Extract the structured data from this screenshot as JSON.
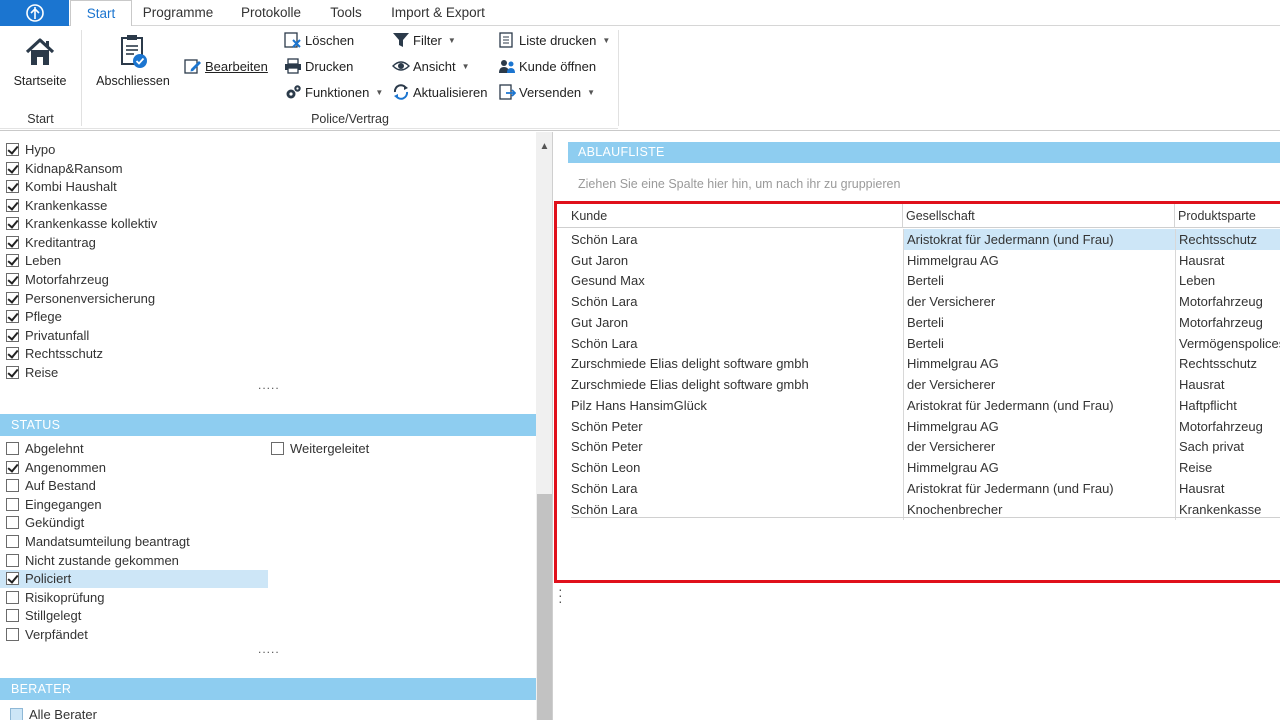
{
  "ribbon_tabs": [
    "Start",
    "Programme",
    "Protokolle",
    "Tools",
    "Import & Export"
  ],
  "ribbon": {
    "start_group": {
      "startseite": "Startseite",
      "label": "Start"
    },
    "police_group": {
      "abschliessen": "Abschliessen",
      "bearbeiten": "Bearbeiten",
      "loeschen": "Löschen",
      "drucken": "Drucken",
      "funktionen": "Funktionen",
      "filter": "Filter",
      "ansicht": "Ansicht",
      "aktualisieren": "Aktualisieren",
      "liste_drucken": "Liste drucken",
      "kunde_oeffnen": "Kunde öffnen",
      "versenden": "Versenden",
      "label": "Police/Vertrag"
    }
  },
  "sparten": [
    {
      "label": "Hypo",
      "checked": true
    },
    {
      "label": "Kidnap&Ransom",
      "checked": true
    },
    {
      "label": "Kombi Haushalt",
      "checked": true
    },
    {
      "label": "Krankenkasse",
      "checked": true
    },
    {
      "label": "Krankenkasse kollektiv",
      "checked": true
    },
    {
      "label": "Kreditantrag",
      "checked": true
    },
    {
      "label": "Leben",
      "checked": true
    },
    {
      "label": "Motorfahrzeug",
      "checked": true
    },
    {
      "label": "Personenversicherung",
      "checked": true
    },
    {
      "label": "Pflege",
      "checked": true
    },
    {
      "label": "Privatunfall",
      "checked": true
    },
    {
      "label": "Rechtsschutz",
      "checked": true
    },
    {
      "label": "Reise",
      "checked": true
    }
  ],
  "more_dots": ".....",
  "status": {
    "header": "STATUS",
    "items": [
      {
        "label": "Abgelehnt",
        "checked": false
      },
      {
        "label": "Angenommen",
        "checked": true
      },
      {
        "label": "Auf Bestand",
        "checked": false
      },
      {
        "label": "Eingegangen",
        "checked": false
      },
      {
        "label": "Gekündigt",
        "checked": false
      },
      {
        "label": "Mandatsumteilung beantragt",
        "checked": false
      },
      {
        "label": "Nicht zustande gekommen",
        "checked": false
      },
      {
        "label": "Policiert",
        "checked": true
      },
      {
        "label": "Risikoprüfung",
        "checked": false
      },
      {
        "label": "Stillgelegt",
        "checked": false
      },
      {
        "label": "Verpfändet",
        "checked": false
      }
    ],
    "extra": {
      "label": "Weitergeleitet",
      "checked": false
    }
  },
  "berater": {
    "header": "BERATER",
    "all_label": "Alle Berater"
  },
  "ablaufliste": {
    "header": "ABLAUFLISTE",
    "group_hint": "Ziehen Sie eine Spalte hier hin, um nach ihr zu gruppieren",
    "columns": [
      "Kunde",
      "Gesellschaft",
      "Produktsparte"
    ],
    "rows": [
      [
        "Schön Lara",
        "Aristokrat für Jedermann (und Frau)",
        "Rechtsschutz"
      ],
      [
        "Gut Jaron",
        "Himmelgrau AG",
        "Hausrat"
      ],
      [
        "Gesund Max",
        "Berteli",
        "Leben"
      ],
      [
        "Schön Lara",
        "der Versicherer",
        "Motorfahrzeug"
      ],
      [
        "Gut Jaron",
        "Berteli",
        "Motorfahrzeug"
      ],
      [
        "Schön Lara",
        "Berteli",
        "Vermögenspolices"
      ],
      [
        "Zurschmiede Elias delight software gmbh",
        "Himmelgrau AG",
        "Rechtsschutz"
      ],
      [
        "Zurschmiede Elias delight software gmbh",
        "der Versicherer",
        "Hausrat"
      ],
      [
        "Pilz Hans HansimGlück",
        "Aristokrat für Jedermann (und Frau)",
        "Haftpflicht"
      ],
      [
        "Schön Peter",
        "Himmelgrau AG",
        "Motorfahrzeug"
      ],
      [
        "Schön Peter",
        "der Versicherer",
        "Sach privat"
      ],
      [
        "Schön Leon",
        "Himmelgrau AG",
        "Reise"
      ],
      [
        "Schön Lara",
        "Aristokrat für Jedermann (und Frau)",
        "Hausrat"
      ],
      [
        "Schön Lara",
        "Knochenbrecher",
        "Krankenkasse"
      ]
    ],
    "selected_row": 0
  },
  "colors": {
    "accent": "#1b75d0",
    "section_header": "#8ecdf0",
    "selection": "#cde6f7",
    "highlight_frame": "#e0101b"
  }
}
